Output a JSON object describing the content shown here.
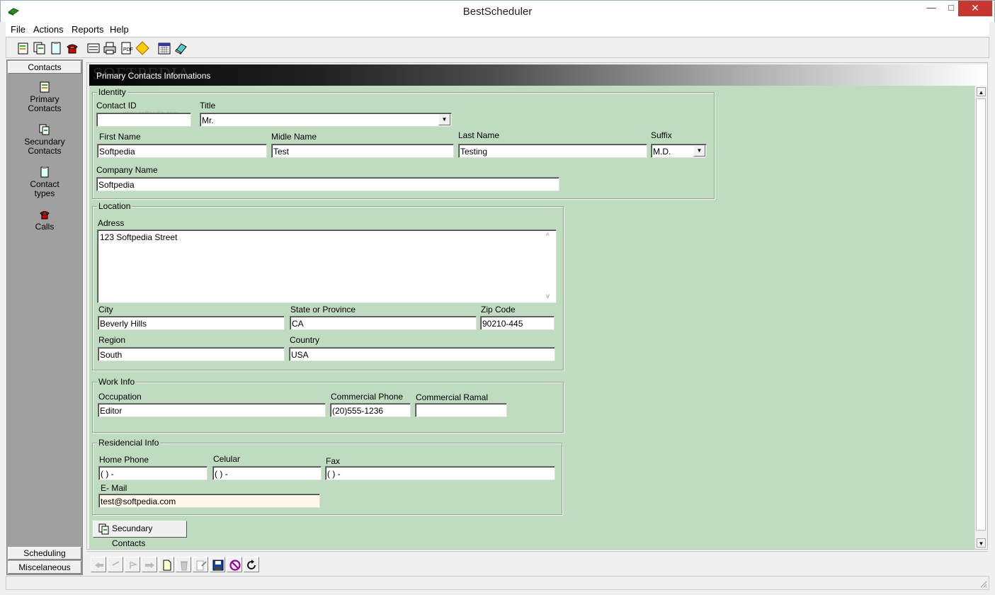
{
  "window": {
    "title": "BestScheduler",
    "minimize": "—",
    "maximize": "□",
    "close": "✕"
  },
  "menu": [
    "File",
    "Actions",
    "Reports",
    "Help"
  ],
  "toolbar": {
    "icons": [
      "primary-contacts-icon",
      "secondary-contacts-icon",
      "contact-types-icon",
      "calls-icon",
      "notes-icon",
      "print-icon",
      "report-icon",
      "warning-diamond-icon",
      "calendar-icon",
      "eraser-icon"
    ]
  },
  "sidebar": {
    "header": "Contacts",
    "items": [
      {
        "line1": "Primary",
        "line2": "Contacts"
      },
      {
        "line1": "Secundary",
        "line2": "Contacts"
      },
      {
        "line1": "Contact",
        "line2": "types"
      },
      {
        "line1": "Calls",
        "line2": ""
      }
    ],
    "footer1": "Scheduling",
    "footer2": "Miscelaneous"
  },
  "panel": {
    "title": "Primary Contacts Informations",
    "watermark": "SOFTPEDIA",
    "watermark_sub": "www.softpedia.com"
  },
  "identity": {
    "legend": "Identity",
    "contact_id_label": "Contact ID",
    "contact_id": "",
    "title_label": "Title",
    "title": "Mr.",
    "first_name_label": "First Name",
    "first_name": "Softpedia",
    "middle_name_label": "Midle Name",
    "middle_name": "Test",
    "last_name_label": "Last Name",
    "last_name": "Testing",
    "suffix_label": "Suffix",
    "suffix": "M.D.",
    "company_label": "Company Name",
    "company": "Softpedia"
  },
  "location": {
    "legend": "Location",
    "address_label": "Adress",
    "address": "123 Softpedia Street",
    "city_label": "City",
    "city": "Beverly Hills",
    "state_label": "State or Province",
    "state": "CA",
    "zip_label": "Zip Code",
    "zip": "90210-445",
    "region_label": "Region",
    "region": "South",
    "country_label": "Country",
    "country": "USA"
  },
  "work": {
    "legend": "Work Info",
    "occupation_label": "Occupation",
    "occupation": "Editor",
    "phone_label": "Commercial Phone",
    "phone": "(20)555-1236",
    "ramal_label": "Commercial Ramal",
    "ramal": ""
  },
  "residencial": {
    "legend": "Residencial Info",
    "home_label": "Home Phone",
    "home": "(  )    -",
    "cel_label": "Celular",
    "cel": "(  )    -",
    "fax_label": "Fax",
    "fax": "(  )    -",
    "email_label": "E- Mail",
    "email": "test@softpedia.com"
  },
  "secundary_button": "Secundary Contacts",
  "navbar": {
    "icons": [
      "first-record-icon",
      "prev-record-icon",
      "next-record-icon",
      "last-record-icon",
      "new-record-icon",
      "delete-record-icon",
      "edit-record-icon",
      "save-icon",
      "cancel-icon",
      "refresh-icon"
    ]
  },
  "colors": {
    "form_bg": "#c0dcc0",
    "email_bg": "#fff7ea",
    "close_red": "#c7372f"
  }
}
